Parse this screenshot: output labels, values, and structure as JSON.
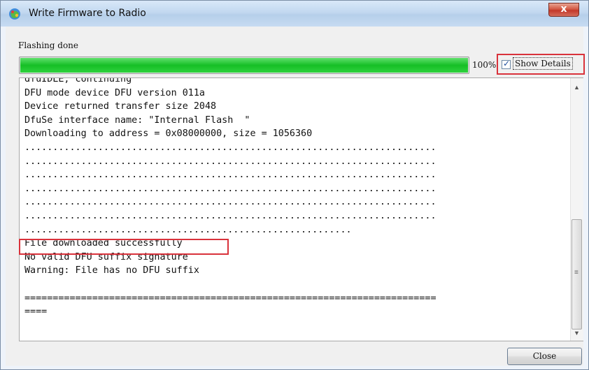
{
  "window": {
    "title": "Write Firmware to Radio",
    "close_glyph": "x"
  },
  "status": {
    "text": "Flashing done",
    "progress_percent": 100,
    "progress_label": "100%"
  },
  "details": {
    "label": "Show Details",
    "checked": true
  },
  "log": {
    "lines": [
      "dfuIDLE, continuing",
      "DFU mode device DFU version 011a",
      "Device returned transfer size 2048",
      "DfuSe interface name: \"Internal Flash  \"",
      "Downloading to address = 0x08000000, size = 1056360",
      ".........................................................................",
      ".........................................................................",
      ".........................................................................",
      ".........................................................................",
      ".........................................................................",
      ".........................................................................",
      "..........................................................",
      "File downloaded successfully",
      "No valid DFU suffix signature",
      "Warning: File has no DFU suffix",
      "",
      "=========================================================================",
      "===="
    ]
  },
  "buttons": {
    "close_label": "Close"
  },
  "colors": {
    "progress_green": "#16bf26",
    "highlight_red": "#d9323b"
  }
}
